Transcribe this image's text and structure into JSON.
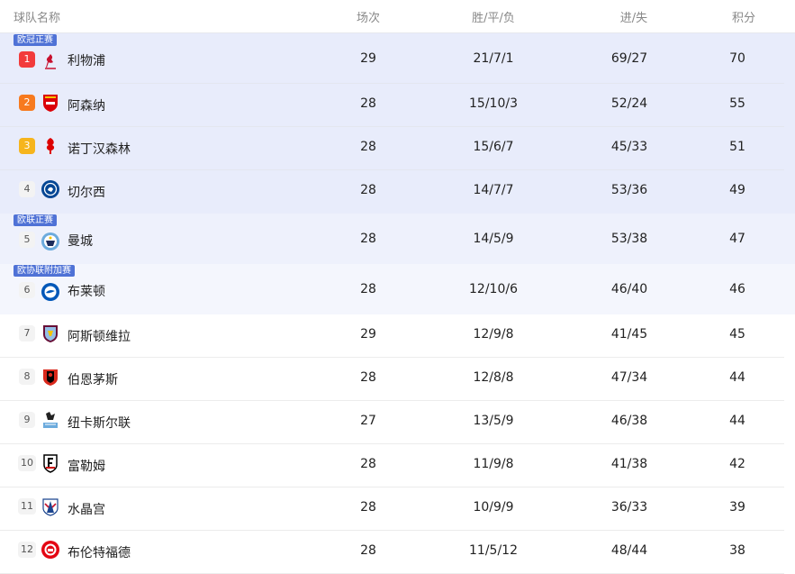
{
  "header": {
    "team": "球队名称",
    "played": "场次",
    "wdl": "胜/平/负",
    "goals": "进/失",
    "points": "积分"
  },
  "zones": {
    "ucl": "欧冠正赛",
    "uel": "欧联正赛",
    "uecl": "欧协联附加赛"
  },
  "rows": [
    {
      "rank": "1",
      "team": "利物浦",
      "played": "29",
      "wdl": "21/7/1",
      "goals": "69/27",
      "points": "70",
      "crest": "liverpool-crest"
    },
    {
      "rank": "2",
      "team": "阿森纳",
      "played": "28",
      "wdl": "15/10/3",
      "goals": "52/24",
      "points": "55",
      "crest": "arsenal-crest"
    },
    {
      "rank": "3",
      "team": "诺丁汉森林",
      "played": "28",
      "wdl": "15/6/7",
      "goals": "45/33",
      "points": "51",
      "crest": "nottingham-forest-crest"
    },
    {
      "rank": "4",
      "team": "切尔西",
      "played": "28",
      "wdl": "14/7/7",
      "goals": "53/36",
      "points": "49",
      "crest": "chelsea-crest"
    },
    {
      "rank": "5",
      "team": "曼城",
      "played": "28",
      "wdl": "14/5/9",
      "goals": "53/38",
      "points": "47",
      "crest": "man-city-crest"
    },
    {
      "rank": "6",
      "team": "布莱顿",
      "played": "28",
      "wdl": "12/10/6",
      "goals": "46/40",
      "points": "46",
      "crest": "brighton-crest"
    },
    {
      "rank": "7",
      "team": "阿斯顿维拉",
      "played": "29",
      "wdl": "12/9/8",
      "goals": "41/45",
      "points": "45",
      "crest": "aston-villa-crest"
    },
    {
      "rank": "8",
      "team": "伯恩茅斯",
      "played": "28",
      "wdl": "12/8/8",
      "goals": "47/34",
      "points": "44",
      "crest": "bournemouth-crest"
    },
    {
      "rank": "9",
      "team": "纽卡斯尔联",
      "played": "27",
      "wdl": "13/5/9",
      "goals": "46/38",
      "points": "44",
      "crest": "newcastle-crest"
    },
    {
      "rank": "10",
      "team": "富勒姆",
      "played": "28",
      "wdl": "11/9/8",
      "goals": "41/38",
      "points": "42",
      "crest": "fulham-crest"
    },
    {
      "rank": "11",
      "team": "水晶宫",
      "played": "28",
      "wdl": "10/9/9",
      "goals": "36/33",
      "points": "39",
      "crest": "crystal-palace-crest"
    },
    {
      "rank": "12",
      "team": "布伦特福德",
      "played": "28",
      "wdl": "11/5/12",
      "goals": "48/44",
      "points": "38",
      "crest": "brentford-crest"
    }
  ],
  "colors": {
    "zone_tag": "#4f72d6",
    "rank1": "#f23b3b",
    "rank2": "#f77a1e",
    "rank3": "#f6b51d"
  }
}
